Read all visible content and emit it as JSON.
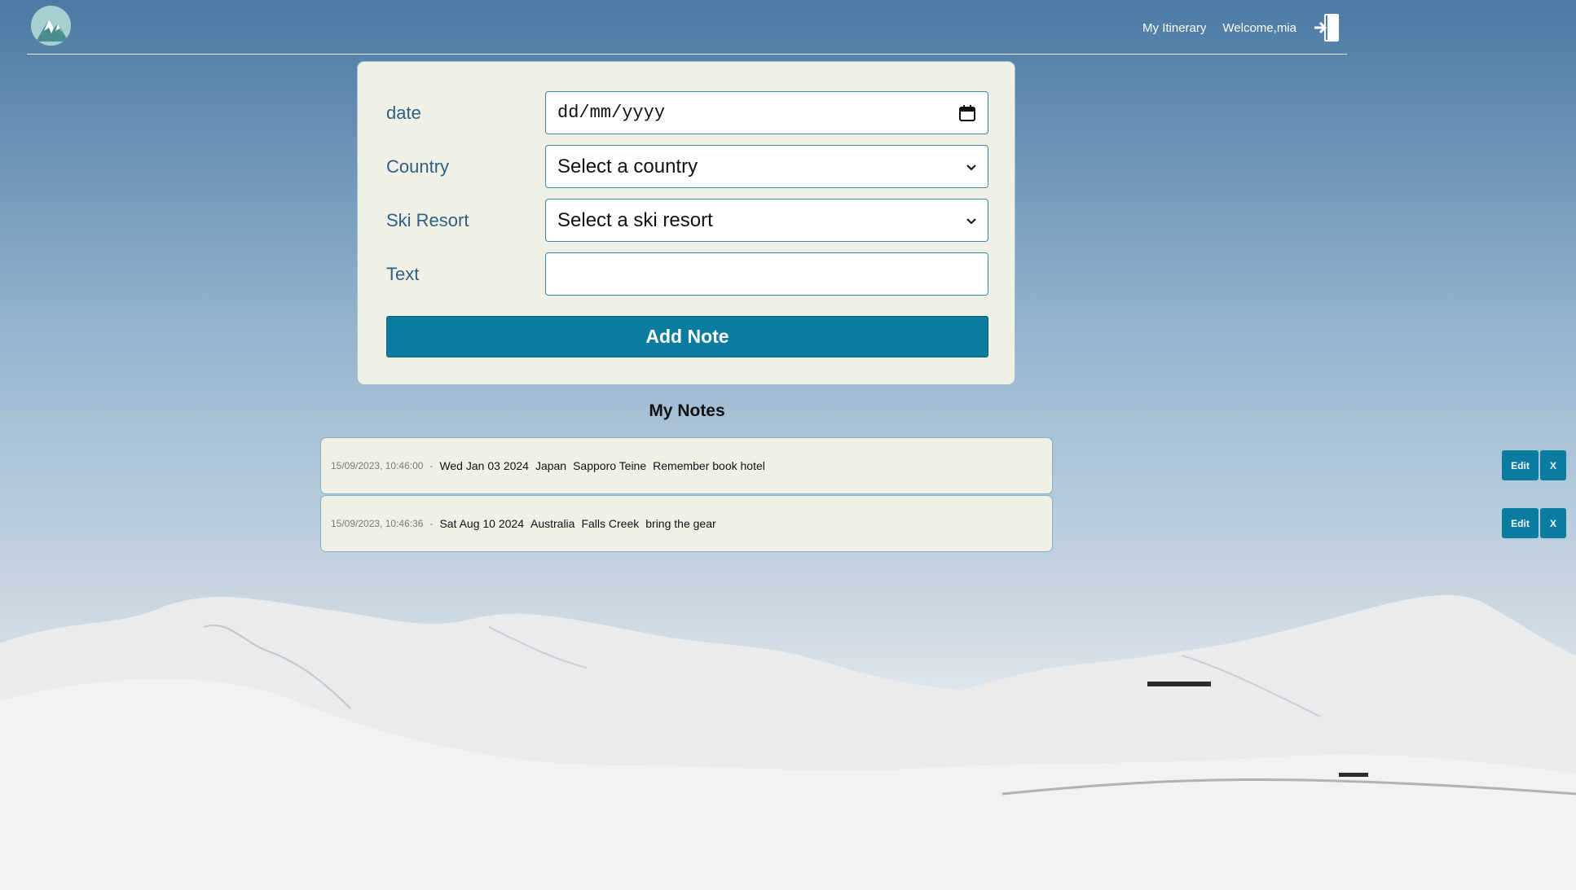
{
  "nav": {
    "itinerary_label": "My Itinerary",
    "welcome_label": "Welcome,mia"
  },
  "form": {
    "date_label": "date",
    "date_placeholder": "dd/mm/yyyy",
    "country_label": "Country",
    "country_selected": "Select a country",
    "resort_label": "Ski Resort",
    "resort_selected": "Select a ski resort",
    "text_label": "Text",
    "text_value": "",
    "submit_label": "Add Note"
  },
  "notes": {
    "title": "My Notes",
    "separator": "-",
    "items": [
      {
        "timestamp": "15/09/2023, 10:46:00",
        "date": "Wed Jan 03 2024",
        "country": "Japan",
        "resort": "Sapporo Teine",
        "text": "Remember book hotel",
        "edit_label": "Edit",
        "delete_label": "X"
      },
      {
        "timestamp": "15/09/2023, 10:46:36",
        "date": "Sat Aug 10 2024",
        "country": "Australia",
        "resort": "Falls Creek",
        "text": "bring the gear",
        "edit_label": "Edit",
        "delete_label": "X"
      }
    ]
  },
  "colors": {
    "accent": "#0a7ca0",
    "card_bg": "#f1f0e6",
    "label": "#2e5f84"
  },
  "icons": {
    "logo": "mountain-logo",
    "logout": "logout-door-icon",
    "date_picker": "calendar-icon",
    "select": "chevron-down-icon"
  }
}
